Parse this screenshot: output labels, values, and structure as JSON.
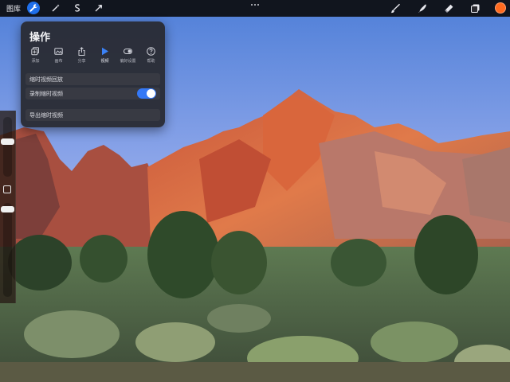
{
  "toolbar": {
    "gallery_label": "图库",
    "action_buttons": [
      {
        "name": "actions",
        "icon": "wrench-icon",
        "active": true
      },
      {
        "name": "adjustments",
        "icon": "magic-wand-icon",
        "active": false
      },
      {
        "name": "selection",
        "icon": "selection-s-icon",
        "active": false
      },
      {
        "name": "transform",
        "icon": "arrow-cursor-icon",
        "active": false
      }
    ],
    "tools": [
      "brush-icon",
      "smudge-icon",
      "eraser-icon",
      "layers-icon"
    ],
    "color_icon": "color-swatch-icon",
    "current_color": "#ff6a1f"
  },
  "actions_panel": {
    "title": "操作",
    "tabs": [
      {
        "label": "添加",
        "icon": "add-icon",
        "active": false
      },
      {
        "label": "画布",
        "icon": "canvas-icon",
        "active": false
      },
      {
        "label": "分享",
        "icon": "share-icon",
        "active": false
      },
      {
        "label": "视频",
        "icon": "play-icon",
        "active": true
      },
      {
        "label": "偏好设置",
        "icon": "toggle-icon",
        "active": false
      },
      {
        "label": "帮助",
        "icon": "help-icon",
        "active": false
      }
    ],
    "rows": [
      {
        "label": "缩时视频回放"
      },
      {
        "label": "录制缩时视频",
        "toggle_on": true
      },
      {
        "label": "导出缩时视频"
      }
    ]
  },
  "colors": {
    "accent": "#1f6feb",
    "toggle_on": "#3478f6"
  }
}
